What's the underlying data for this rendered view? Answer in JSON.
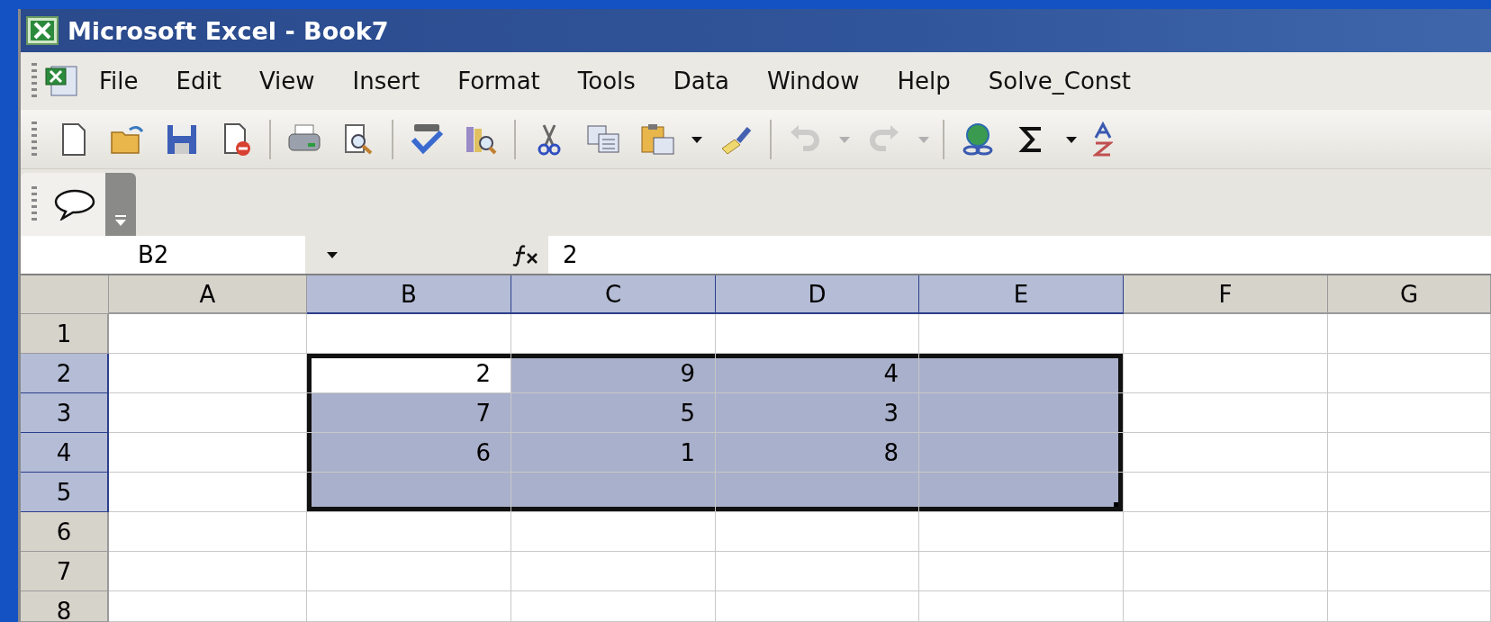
{
  "window": {
    "title": "Microsoft Excel - Book7"
  },
  "menu": [
    {
      "label": "File"
    },
    {
      "label": "Edit"
    },
    {
      "label": "View"
    },
    {
      "label": "Insert"
    },
    {
      "label": "Format"
    },
    {
      "label": "Tools"
    },
    {
      "label": "Data"
    },
    {
      "label": "Window"
    },
    {
      "label": "Help"
    },
    {
      "label": "Solve_Const"
    }
  ],
  "toolbar": [
    {
      "kind": "button"
    },
    {
      "kind": "button"
    },
    {
      "kind": "button"
    },
    {
      "kind": "button"
    },
    {
      "kind": "separator"
    },
    {
      "kind": "button"
    },
    {
      "kind": "button"
    },
    {
      "kind": "separator"
    },
    {
      "kind": "button"
    },
    {
      "kind": "button"
    },
    {
      "kind": "separator"
    },
    {
      "kind": "button"
    },
    {
      "kind": "button"
    },
    {
      "kind": "button"
    },
    {
      "kind": "caret"
    },
    {
      "kind": "button"
    },
    {
      "kind": "separator"
    },
    {
      "kind": "button",
      "disabled": true
    },
    {
      "kind": "caret",
      "disabled": true
    },
    {
      "kind": "button",
      "disabled": true
    },
    {
      "kind": "caret",
      "disabled": true
    },
    {
      "kind": "separator"
    },
    {
      "kind": "button"
    },
    {
      "kind": "button"
    },
    {
      "kind": "caret"
    },
    {
      "kind": "button"
    }
  ],
  "formula_bar": {
    "name_box": "B2",
    "value": "2"
  },
  "sheet": {
    "columns": [
      {
        "label": "A",
        "selected": false
      },
      {
        "label": "B",
        "selected": true
      },
      {
        "label": "C",
        "selected": true
      },
      {
        "label": "D",
        "selected": true
      },
      {
        "label": "E",
        "selected": true
      },
      {
        "label": "F",
        "selected": false
      },
      {
        "label": "G",
        "selected": false
      }
    ],
    "rows": [
      {
        "label": "1",
        "selected": false,
        "cells": [
          {
            "selected": false
          },
          {
            "selected": false
          },
          {
            "selected": false
          },
          {
            "selected": false
          },
          {
            "selected": false
          },
          {
            "selected": false
          },
          {
            "selected": false
          }
        ]
      },
      {
        "label": "2",
        "selected": true,
        "cells": [
          {
            "selected": false
          },
          {
            "selected": true,
            "active": true,
            "value": "2"
          },
          {
            "selected": true,
            "active": false,
            "value": "9"
          },
          {
            "selected": true,
            "active": false,
            "value": "4"
          },
          {
            "selected": true,
            "active": false
          },
          {
            "selected": false
          },
          {
            "selected": false
          }
        ]
      },
      {
        "label": "3",
        "selected": true,
        "cells": [
          {
            "selected": false
          },
          {
            "selected": true,
            "active": false,
            "value": "7"
          },
          {
            "selected": true,
            "active": false,
            "value": "5"
          },
          {
            "selected": true,
            "active": false,
            "value": "3"
          },
          {
            "selected": true,
            "active": false
          },
          {
            "selected": false
          },
          {
            "selected": false
          }
        ]
      },
      {
        "label": "4",
        "selected": true,
        "cells": [
          {
            "selected": false
          },
          {
            "selected": true,
            "active": false,
            "value": "6"
          },
          {
            "selected": true,
            "active": false,
            "value": "1"
          },
          {
            "selected": true,
            "active": false,
            "value": "8"
          },
          {
            "selected": true,
            "active": false
          },
          {
            "selected": false
          },
          {
            "selected": false
          }
        ]
      },
      {
        "label": "5",
        "selected": true,
        "cells": [
          {
            "selected": false
          },
          {
            "selected": true,
            "active": false
          },
          {
            "selected": true,
            "active": false
          },
          {
            "selected": true,
            "active": false
          },
          {
            "selected": true,
            "active": false
          },
          {
            "selected": false
          },
          {
            "selected": false
          }
        ]
      },
      {
        "label": "6",
        "selected": false,
        "cells": [
          {
            "selected": false
          },
          {
            "selected": false
          },
          {
            "selected": false
          },
          {
            "selected": false
          },
          {
            "selected": false
          },
          {
            "selected": false
          },
          {
            "selected": false
          }
        ]
      },
      {
        "label": "7",
        "selected": false,
        "cells": [
          {
            "selected": false
          },
          {
            "selected": false
          },
          {
            "selected": false
          },
          {
            "selected": false
          },
          {
            "selected": false
          },
          {
            "selected": false
          },
          {
            "selected": false
          }
        ]
      },
      {
        "label": "8",
        "selected": false,
        "cells": [
          {
            "selected": false
          },
          {
            "selected": false
          },
          {
            "selected": false
          },
          {
            "selected": false
          },
          {
            "selected": false
          },
          {
            "selected": false
          },
          {
            "selected": false
          }
        ]
      }
    ]
  }
}
